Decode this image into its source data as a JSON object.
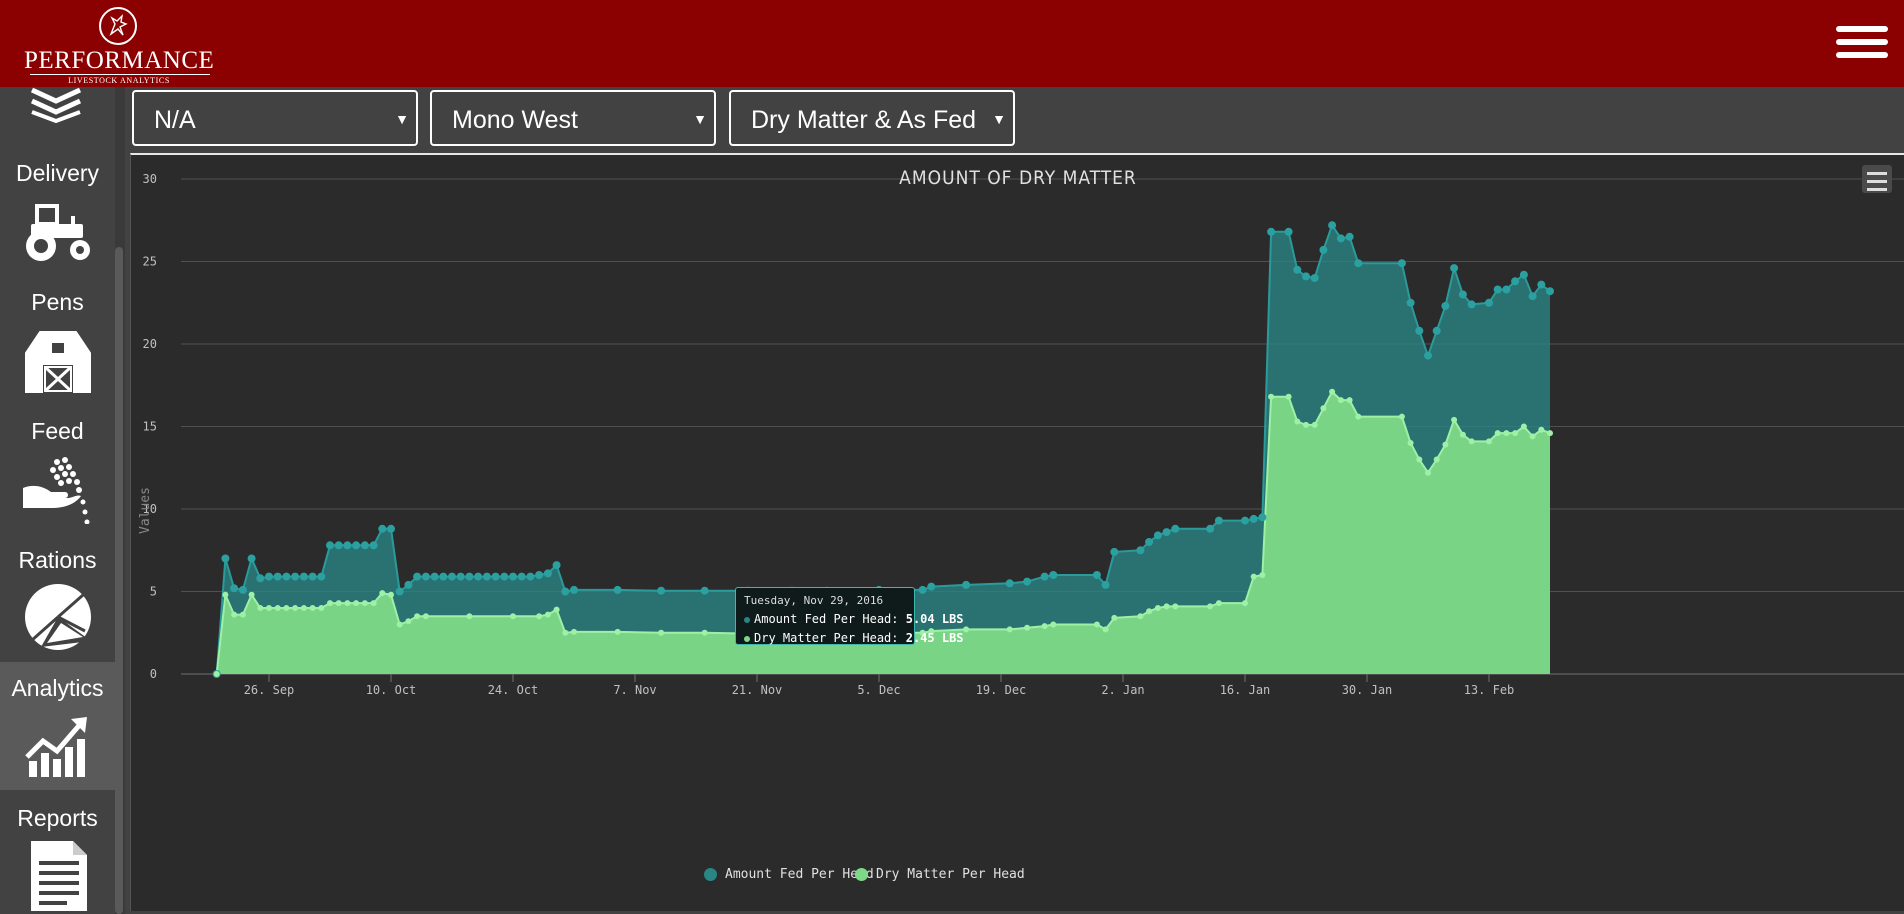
{
  "brand": {
    "name": "PERFORMANCE",
    "tagline": "LIVESTOCK ANALYTICS"
  },
  "nav": {
    "menu_icon": "hamburger-menu-icon",
    "items": [
      {
        "label": "Delivery",
        "icon": "tractor-icon",
        "active": false
      },
      {
        "label": "Pens",
        "icon": "barn-icon",
        "active": false
      },
      {
        "label": "Feed",
        "icon": "hand-feed-icon",
        "active": false
      },
      {
        "label": "Rations",
        "icon": "pie-chart-icon",
        "active": false
      },
      {
        "label": "Analytics",
        "icon": "trend-chart-icon",
        "active": true
      },
      {
        "label": "Reports",
        "icon": "document-icon",
        "active": false
      }
    ]
  },
  "filters": [
    {
      "value": "N/A"
    },
    {
      "value": "Mono West"
    },
    {
      "value": "Dry Matter & As Fed"
    }
  ],
  "tooltip": {
    "date": "Tuesday, Nov 29, 2016",
    "rows": [
      {
        "label": "Amount Fed Per Head:",
        "value": "5.04 LBS"
      },
      {
        "label": "Dry Matter Per Head:",
        "value": "2.45 LBS"
      }
    ]
  },
  "colors": {
    "header": "#8b0000",
    "amount_series": "#2a8585",
    "dry_series": "#7ed987",
    "background": "#2b2b2b"
  },
  "chart_data": {
    "type": "area",
    "title": "AMOUNT OF DRY MATTER",
    "ylabel": "Values",
    "ylim": [
      0,
      30
    ],
    "yticks": [
      0,
      5,
      10,
      15,
      20,
      25,
      30
    ],
    "xticks": [
      "26. Sep",
      "10. Oct",
      "24. Oct",
      "7. Nov",
      "21. Nov",
      "5. Dec",
      "19. Dec",
      "2. Jan",
      "16. Jan",
      "30. Jan",
      "13. Feb"
    ],
    "xtick_dates": [
      "2016-09-26",
      "2016-10-10",
      "2016-10-24",
      "2016-11-07",
      "2016-11-21",
      "2016-12-05",
      "2016-12-19",
      "2017-01-02",
      "2017-01-16",
      "2017-01-30",
      "2017-02-13"
    ],
    "x_range": [
      "2016-09-20",
      "2017-02-26"
    ],
    "grid": true,
    "legend_position": "bottom-center",
    "series": [
      {
        "name": "Amount Fed Per Head",
        "color": "#2a8585",
        "points": [
          [
            "2016-09-20",
            0
          ],
          [
            "2016-09-21",
            7.0
          ],
          [
            "2016-09-22",
            5.2
          ],
          [
            "2016-09-23",
            5.1
          ],
          [
            "2016-09-24",
            7.0
          ],
          [
            "2016-09-25",
            5.8
          ],
          [
            "2016-09-26",
            5.9
          ],
          [
            "2016-09-27",
            5.9
          ],
          [
            "2016-09-28",
            5.9
          ],
          [
            "2016-09-29",
            5.9
          ],
          [
            "2016-09-30",
            5.9
          ],
          [
            "2016-10-01",
            5.9
          ],
          [
            "2016-10-02",
            5.9
          ],
          [
            "2016-10-03",
            7.8
          ],
          [
            "2016-10-04",
            7.8
          ],
          [
            "2016-10-05",
            7.8
          ],
          [
            "2016-10-06",
            7.8
          ],
          [
            "2016-10-07",
            7.8
          ],
          [
            "2016-10-08",
            7.8
          ],
          [
            "2016-10-09",
            8.8
          ],
          [
            "2016-10-10",
            8.8
          ],
          [
            "2016-10-11",
            5.0
          ],
          [
            "2016-10-12",
            5.4
          ],
          [
            "2016-10-13",
            5.9
          ],
          [
            "2016-10-14",
            5.9
          ],
          [
            "2016-10-15",
            5.9
          ],
          [
            "2016-10-16",
            5.9
          ],
          [
            "2016-10-17",
            5.9
          ],
          [
            "2016-10-18",
            5.9
          ],
          [
            "2016-10-19",
            5.9
          ],
          [
            "2016-10-20",
            5.9
          ],
          [
            "2016-10-21",
            5.9
          ],
          [
            "2016-10-22",
            5.9
          ],
          [
            "2016-10-23",
            5.9
          ],
          [
            "2016-10-24",
            5.9
          ],
          [
            "2016-10-25",
            5.9
          ],
          [
            "2016-10-26",
            5.9
          ],
          [
            "2016-10-27",
            6.0
          ],
          [
            "2016-10-28",
            6.1
          ],
          [
            "2016-10-29",
            6.6
          ],
          [
            "2016-10-30",
            5.0
          ],
          [
            "2016-10-31",
            5.1
          ],
          [
            "2016-11-05",
            5.1
          ],
          [
            "2016-11-10",
            5.05
          ],
          [
            "2016-11-15",
            5.05
          ],
          [
            "2016-11-20",
            5.05
          ],
          [
            "2016-11-25",
            5.04
          ],
          [
            "2016-11-29",
            5.04
          ],
          [
            "2016-12-05",
            5.1
          ],
          [
            "2016-12-10",
            5.1
          ],
          [
            "2016-12-11",
            5.3
          ],
          [
            "2016-12-15",
            5.4
          ],
          [
            "2016-12-20",
            5.5
          ],
          [
            "2016-12-22",
            5.6
          ],
          [
            "2016-12-24",
            5.9
          ],
          [
            "2016-12-25",
            6.0
          ],
          [
            "2016-12-30",
            6.0
          ],
          [
            "2016-12-31",
            5.4
          ],
          [
            "2017-01-01",
            7.4
          ],
          [
            "2017-01-04",
            7.5
          ],
          [
            "2017-01-05",
            8.0
          ],
          [
            "2017-01-06",
            8.4
          ],
          [
            "2017-01-07",
            8.6
          ],
          [
            "2017-01-08",
            8.8
          ],
          [
            "2017-01-12",
            8.8
          ],
          [
            "2017-01-13",
            9.3
          ],
          [
            "2017-01-16",
            9.3
          ],
          [
            "2017-01-17",
            9.4
          ],
          [
            "2017-01-18",
            9.5
          ],
          [
            "2017-01-19",
            26.8
          ],
          [
            "2017-01-21",
            26.8
          ],
          [
            "2017-01-22",
            24.5
          ],
          [
            "2017-01-23",
            24.1
          ],
          [
            "2017-01-24",
            24.0
          ],
          [
            "2017-01-25",
            25.7
          ],
          [
            "2017-01-26",
            27.2
          ],
          [
            "2017-01-27",
            26.4
          ],
          [
            "2017-01-28",
            26.5
          ],
          [
            "2017-01-29",
            24.9
          ],
          [
            "2017-02-03",
            24.9
          ],
          [
            "2017-02-04",
            22.5
          ],
          [
            "2017-02-05",
            20.8
          ],
          [
            "2017-02-06",
            19.3
          ],
          [
            "2017-02-07",
            20.8
          ],
          [
            "2017-02-08",
            22.3
          ],
          [
            "2017-02-09",
            24.6
          ],
          [
            "2017-02-10",
            23.0
          ],
          [
            "2017-02-11",
            22.4
          ],
          [
            "2017-02-13",
            22.5
          ],
          [
            "2017-02-14",
            23.3
          ],
          [
            "2017-02-15",
            23.3
          ],
          [
            "2017-02-16",
            23.8
          ],
          [
            "2017-02-17",
            24.2
          ],
          [
            "2017-02-18",
            22.9
          ],
          [
            "2017-02-19",
            23.6
          ],
          [
            "2017-02-20",
            23.2
          ]
        ]
      },
      {
        "name": "Dry Matter Per Head",
        "color": "#7ed987",
        "points": [
          [
            "2016-09-20",
            0
          ],
          [
            "2016-09-21",
            4.8
          ],
          [
            "2016-09-22",
            3.6
          ],
          [
            "2016-09-23",
            3.6
          ],
          [
            "2016-09-24",
            4.8
          ],
          [
            "2016-09-25",
            4.0
          ],
          [
            "2016-09-26",
            4.0
          ],
          [
            "2016-09-27",
            4.0
          ],
          [
            "2016-09-28",
            4.0
          ],
          [
            "2016-09-29",
            4.0
          ],
          [
            "2016-09-30",
            4.0
          ],
          [
            "2016-10-01",
            4.0
          ],
          [
            "2016-10-02",
            4.0
          ],
          [
            "2016-10-03",
            4.3
          ],
          [
            "2016-10-04",
            4.3
          ],
          [
            "2016-10-05",
            4.3
          ],
          [
            "2016-10-06",
            4.3
          ],
          [
            "2016-10-07",
            4.3
          ],
          [
            "2016-10-08",
            4.3
          ],
          [
            "2016-10-09",
            4.9
          ],
          [
            "2016-10-10",
            4.8
          ],
          [
            "2016-10-11",
            3.0
          ],
          [
            "2016-10-12",
            3.2
          ],
          [
            "2016-10-13",
            3.5
          ],
          [
            "2016-10-14",
            3.5
          ],
          [
            "2016-10-19",
            3.5
          ],
          [
            "2016-10-24",
            3.5
          ],
          [
            "2016-10-27",
            3.5
          ],
          [
            "2016-10-28",
            3.6
          ],
          [
            "2016-10-29",
            3.9
          ],
          [
            "2016-10-30",
            2.5
          ],
          [
            "2016-10-31",
            2.55
          ],
          [
            "2016-11-05",
            2.55
          ],
          [
            "2016-11-10",
            2.5
          ],
          [
            "2016-11-15",
            2.5
          ],
          [
            "2016-11-20",
            2.45
          ],
          [
            "2016-11-25",
            2.45
          ],
          [
            "2016-11-29",
            2.45
          ],
          [
            "2016-12-05",
            2.5
          ],
          [
            "2016-12-10",
            2.5
          ],
          [
            "2016-12-11",
            2.6
          ],
          [
            "2016-12-15",
            2.7
          ],
          [
            "2016-12-20",
            2.7
          ],
          [
            "2016-12-22",
            2.8
          ],
          [
            "2016-12-24",
            2.9
          ],
          [
            "2016-12-25",
            3.0
          ],
          [
            "2016-12-30",
            3.0
          ],
          [
            "2016-12-31",
            2.7
          ],
          [
            "2017-01-01",
            3.4
          ],
          [
            "2017-01-04",
            3.5
          ],
          [
            "2017-01-05",
            3.8
          ],
          [
            "2017-01-06",
            4.0
          ],
          [
            "2017-01-07",
            4.1
          ],
          [
            "2017-01-08",
            4.1
          ],
          [
            "2017-01-12",
            4.1
          ],
          [
            "2017-01-13",
            4.3
          ],
          [
            "2017-01-16",
            4.3
          ],
          [
            "2017-01-17",
            5.9
          ],
          [
            "2017-01-18",
            6.0
          ],
          [
            "2017-01-19",
            16.8
          ],
          [
            "2017-01-21",
            16.8
          ],
          [
            "2017-01-22",
            15.3
          ],
          [
            "2017-01-23",
            15.1
          ],
          [
            "2017-01-24",
            15.1
          ],
          [
            "2017-01-25",
            16.1
          ],
          [
            "2017-01-26",
            17.1
          ],
          [
            "2017-01-27",
            16.6
          ],
          [
            "2017-01-28",
            16.6
          ],
          [
            "2017-01-29",
            15.6
          ],
          [
            "2017-02-03",
            15.6
          ],
          [
            "2017-02-04",
            14.0
          ],
          [
            "2017-02-05",
            13.0
          ],
          [
            "2017-02-06",
            12.2
          ],
          [
            "2017-02-07",
            13.0
          ],
          [
            "2017-02-08",
            13.9
          ],
          [
            "2017-02-09",
            15.4
          ],
          [
            "2017-02-10",
            14.5
          ],
          [
            "2017-02-11",
            14.1
          ],
          [
            "2017-02-13",
            14.1
          ],
          [
            "2017-02-14",
            14.6
          ],
          [
            "2017-02-15",
            14.6
          ],
          [
            "2017-02-16",
            14.6
          ],
          [
            "2017-02-17",
            15.0
          ],
          [
            "2017-02-18",
            14.4
          ],
          [
            "2017-02-19",
            14.8
          ],
          [
            "2017-02-20",
            14.6
          ]
        ]
      }
    ]
  }
}
